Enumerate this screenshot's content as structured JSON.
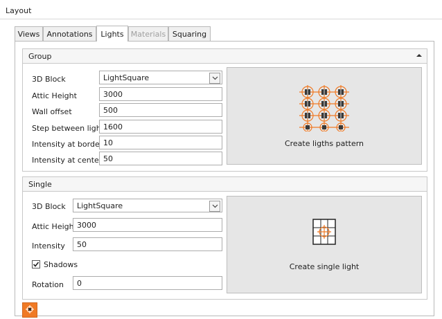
{
  "window": {
    "title": "Layout"
  },
  "tabs": [
    {
      "label": "Views"
    },
    {
      "label": "Annotations"
    },
    {
      "label": "Lights"
    },
    {
      "label": "Materials"
    },
    {
      "label": "Squaring"
    }
  ],
  "group": {
    "header": "Group",
    "fields": {
      "block_label": "3D Block",
      "block_value": "LightSquare",
      "attic_label": "Attic Height",
      "attic_value": "3000",
      "wall_label": "Wall offset",
      "wall_value": "500",
      "step_label": "Step between lights",
      "step_value": "1600",
      "border_label": "Intensity at border",
      "border_value": "10",
      "center_label": "Intensity at center",
      "center_value": "50"
    },
    "button_label": "Create ligths pattern"
  },
  "single": {
    "header": "Single",
    "fields": {
      "block_label": "3D Block",
      "block_value": "LightSquare",
      "attic_label": "Attic Height",
      "attic_value": "3000",
      "intensity_label": "Intensity",
      "intensity_value": "50",
      "shadows_label": "Shadows",
      "shadows_checked": true,
      "rotation_label": "Rotation",
      "rotation_value": "0"
    },
    "button_label": "Create single light"
  },
  "colors": {
    "accent": "#f07a25",
    "button_bg": "#e6e6e6"
  },
  "icons": {
    "collapse": "chevron-up-icon",
    "dropdown": "chevron-down-icon",
    "pattern": "light-grid-icon",
    "single": "single-light-icon",
    "footer": "light-tool-icon"
  }
}
